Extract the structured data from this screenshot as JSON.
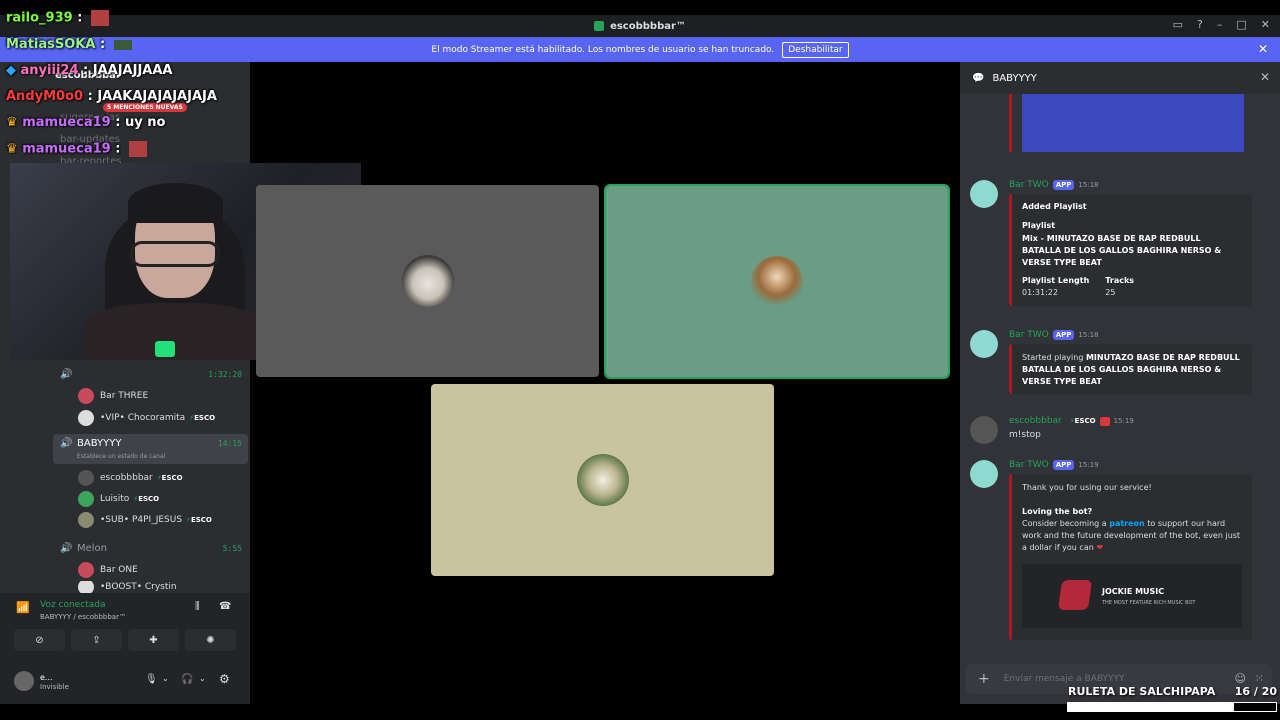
{
  "window": {
    "title": "escobbbbar™"
  },
  "banner": {
    "text": "El modo Streamer está habilitado. Los nombres de usuario se han truncado.",
    "button": "Deshabilitar"
  },
  "overlay_chat": [
    {
      "user": "railo_939",
      "sep": " :",
      "msg": "",
      "color": "#7cfc3a"
    },
    {
      "user": "MatiasSOKA",
      "sep": " :",
      "msg": "",
      "color": "#9af28a"
    },
    {
      "user": "anyiii24",
      "sep": " :",
      "msg": " JAAJAJJAAA",
      "color": "#ff6fc1"
    },
    {
      "user": "AndyM0o0",
      "sep": " :",
      "msg": " JAAKAJAJAJAJAJA",
      "color": "#ff3a3a"
    },
    {
      "user": "mamueca19",
      "sep": " :",
      "msg": " uy no",
      "color": "#c66cff"
    },
    {
      "user": "mamueca19",
      "sep": " :",
      "msg": "",
      "color": "#c66cff"
    }
  ],
  "sidebar": {
    "server_name": "escobbbbar",
    "mentions_pill": "5 MENCIONES NUEVAS",
    "faded_channels": [
      "sugerencias",
      "bar-updates",
      "bar-reportes"
    ],
    "voice": {
      "chan1_time": "1:32:20",
      "bar_three": "Bar THREE",
      "chocoramita": "•VIP• Chocoramita",
      "babyyyy": "BABYYYY",
      "babyyyy_time": "14:15",
      "babyyyy_status": "Establece un estado de canal",
      "escobbbbar": "escobbbbar",
      "luisito": "Luisito",
      "p4pi": "•SUB• P4PI_JESUS",
      "melon": "Melon",
      "melon_time": "5:55",
      "bar_one": "Bar ONE",
      "crystin": "•BOOST• Crystin",
      "esco_tag": "ESCO"
    },
    "voice_connected": {
      "status": "Voz conectada",
      "sub": "BABYYYY / escobbbbar™"
    },
    "user": {
      "name": "e...",
      "status": "Invisible"
    }
  },
  "right_panel": {
    "header": "BABYYYY",
    "messages": {
      "m1": {
        "name": "Bar TWO",
        "tag": "APP",
        "time": "15:18",
        "title": "Added Playlist",
        "playlist_label": "Playlist",
        "playlist": "Mix - MINUTAZO BASE DE RAP REDBULL BATALLA DE LOS GALLOS BAGHIRA NERSO & VERSE TYPE BEAT",
        "length_label": "Playlist Length",
        "length": "01:31:22",
        "tracks_label": "Tracks",
        "tracks": "25"
      },
      "m2": {
        "name": "Bar TWO",
        "tag": "APP",
        "time": "15:18",
        "text_pre": "Started playing ",
        "text_bold": "MINUTAZO BASE DE RAP REDBULL BATALLA DE LOS GALLOS BAGHIRA NERSO & VERSE TYPE BEAT"
      },
      "m3": {
        "name": "escobbbbar",
        "tag": "ESCO",
        "time": "15:19",
        "text": "m!stop"
      },
      "m4": {
        "name": "Bar TWO",
        "tag": "APP",
        "time": "15:19",
        "thanks": "Thank you for using our service!",
        "loving": "Loving the bot?",
        "body_pre": "Consider becoming a ",
        "link": "patreon",
        "body_post": " to support our hard work and the future development of the bot, even just a dollar if you can",
        "heart": "❤",
        "promo_title": "JOCKIE MUSIC",
        "promo_sub": "THE MOST FEATURE RICH MUSIC BOT"
      }
    },
    "input_placeholder": "Enviar mensaje a BABYYYY"
  },
  "roulette": {
    "label": "RULETA DE SALCHIPAPA",
    "current": "16",
    "total": " / 20",
    "progress": 0.8
  },
  "colors": {
    "accent": "#5865f2",
    "online": "#23a55a",
    "embed_border": "#b0171f"
  }
}
